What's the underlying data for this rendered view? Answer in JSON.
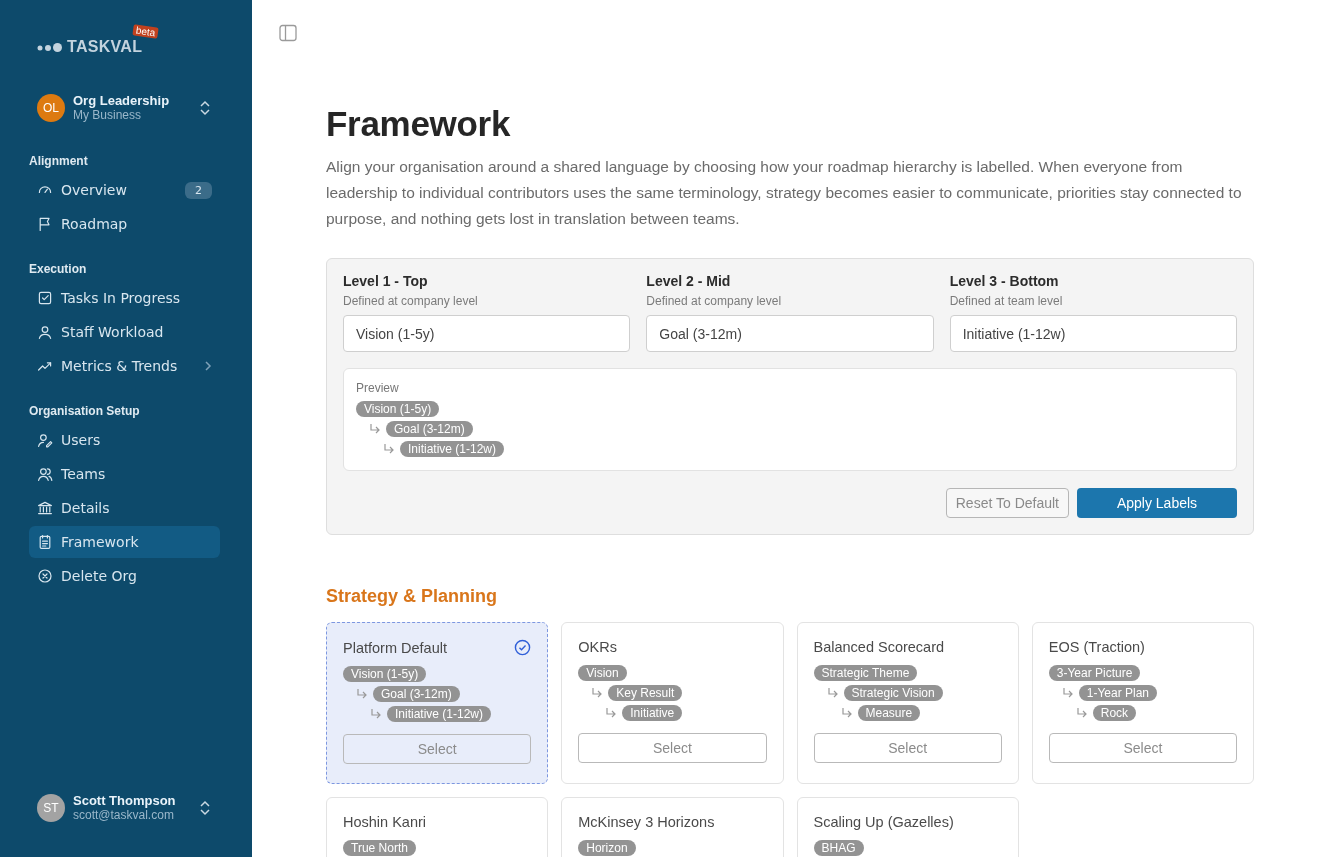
{
  "sidebar": {
    "logo": {
      "name": "TASKVAL",
      "badge": "beta"
    },
    "org": {
      "initials": "OL",
      "name": "Org Leadership",
      "subtitle": "My Business"
    },
    "sections": [
      {
        "title": "Alignment",
        "items": [
          {
            "label": "Overview",
            "badge": "2",
            "selected": false
          },
          {
            "label": "Roadmap",
            "selected": false
          }
        ]
      },
      {
        "title": "Execution",
        "items": [
          {
            "label": "Tasks In Progress",
            "selected": false
          },
          {
            "label": "Staff Workload",
            "selected": false
          },
          {
            "label": "Metrics & Trends",
            "selected": false,
            "has_submenu": true
          }
        ]
      },
      {
        "title": "Organisation Setup",
        "items": [
          {
            "label": "Users",
            "selected": false
          },
          {
            "label": "Teams",
            "selected": false
          },
          {
            "label": "Details",
            "selected": false
          },
          {
            "label": "Framework",
            "selected": true
          },
          {
            "label": "Delete Org",
            "selected": false
          }
        ]
      }
    ],
    "user": {
      "initials": "ST",
      "name": "Scott Thompson",
      "email": "scott@taskval.com"
    }
  },
  "page": {
    "title": "Framework",
    "description": "Align your organisation around a shared language by choosing how your roadmap hierarchy is labelled. When everyone from leadership to individual contributors uses the same terminology, strategy becomes easier to communicate, priorities stay connected to purpose, and nothing gets lost in translation between teams."
  },
  "levels": [
    {
      "title": "Level 1 - Top",
      "hint": "Defined at company level",
      "value": "Vision (1-5y)"
    },
    {
      "title": "Level 2 - Mid",
      "hint": "Defined at company level",
      "value": "Goal (3-12m)"
    },
    {
      "title": "Level 3 - Bottom",
      "hint": "Defined at team level",
      "value": "Initiative (1-12w)"
    }
  ],
  "preview": {
    "label": "Preview",
    "tree": {
      "label": "Vision (1-5y)",
      "children": [
        {
          "label": "Goal (3-12m)",
          "children": [
            {
              "label": "Initiative (1-12w)"
            }
          ]
        }
      ]
    }
  },
  "actions": {
    "reset": "Reset To Default",
    "apply": "Apply Labels"
  },
  "section_title": "Strategy & Planning",
  "frameworks": [
    {
      "name": "Platform Default",
      "selected": true,
      "button": "Select",
      "tree": {
        "label": "Vision (1-5y)",
        "children": [
          {
            "label": "Goal (3-12m)",
            "children": [
              {
                "label": "Initiative (1-12w)"
              }
            ]
          }
        ]
      }
    },
    {
      "name": "OKRs",
      "selected": false,
      "button": "Select",
      "tree": {
        "label": "Vision",
        "children": [
          {
            "label": "Key Result",
            "children": [
              {
                "label": "Initiative"
              }
            ]
          }
        ]
      }
    },
    {
      "name": "Balanced Scorecard",
      "selected": false,
      "button": "Select",
      "tree": {
        "label": "Strategic Theme",
        "children": [
          {
            "label": "Strategic Vision",
            "children": [
              {
                "label": "Measure"
              }
            ]
          }
        ]
      }
    },
    {
      "name": "EOS (Traction)",
      "selected": false,
      "button": "Select",
      "tree": {
        "label": "3-Year Picture",
        "children": [
          {
            "label": "1-Year Plan",
            "children": [
              {
                "label": "Rock"
              }
            ]
          }
        ]
      }
    },
    {
      "name": "Hoshin Kanri",
      "selected": false,
      "tree": {
        "label": "True North"
      }
    },
    {
      "name": "McKinsey 3 Horizons",
      "selected": false,
      "tree": {
        "label": "Horizon"
      }
    },
    {
      "name": "Scaling Up (Gazelles)",
      "selected": false,
      "tree": {
        "label": "BHAG"
      }
    }
  ]
}
